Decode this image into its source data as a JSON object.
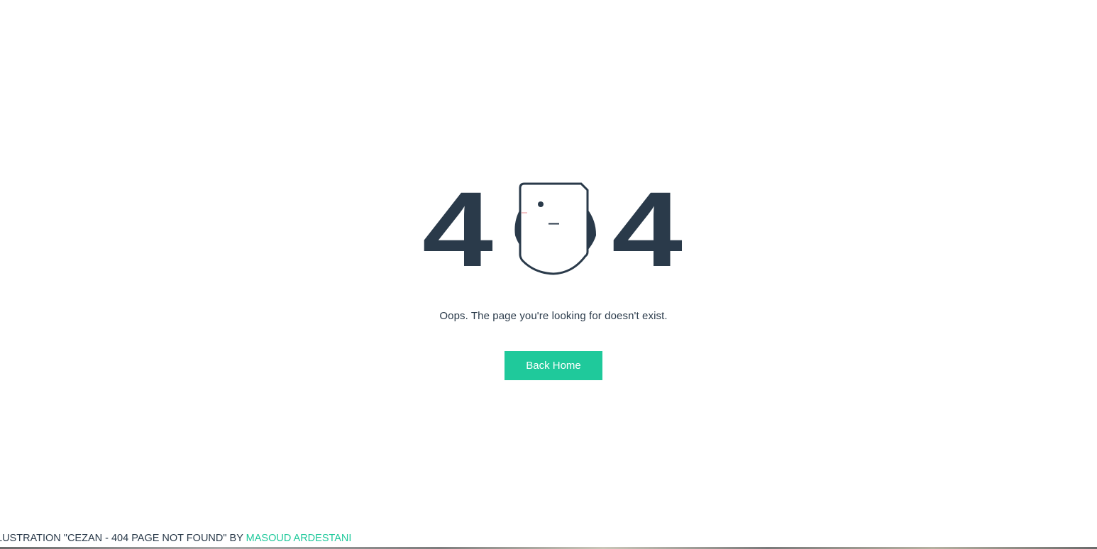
{
  "error": {
    "digit_left": "4",
    "digit_right": "4",
    "message": "Oops. The page you're looking for doesn't exist."
  },
  "actions": {
    "back_home_label": "Back Home"
  },
  "credit": {
    "prefix": "LUSTRATION \"CEZAN - 404 PAGE NOT FOUND\" BY ",
    "author": "MASOUD ARDESTANI"
  },
  "colors": {
    "text_dark": "#2a3a4a",
    "accent": "#1fc99b",
    "background": "#ffffff"
  }
}
